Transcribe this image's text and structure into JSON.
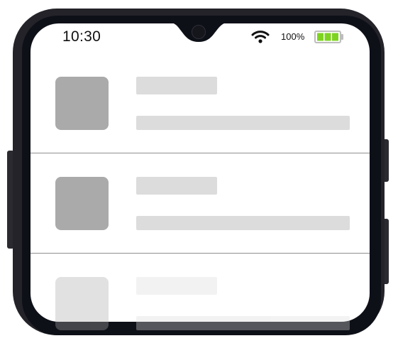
{
  "status_bar": {
    "time": "10:30",
    "battery_percent_text": "100%",
    "battery_level": 1.0,
    "wifi_icon": "wifi-icon",
    "battery_icon": "battery-icon",
    "battery_color": "#7ed321"
  },
  "list": {
    "items": [
      {
        "state": "loading-placeholder"
      },
      {
        "state": "loading-placeholder"
      },
      {
        "state": "loading-placeholder"
      }
    ]
  },
  "colors": {
    "frame": "#232329",
    "frame_inner": "#0e1018",
    "placeholder_thumb": "#aaaaaa",
    "placeholder_line": "#dcdcdc",
    "divider": "#8f8f8f"
  }
}
